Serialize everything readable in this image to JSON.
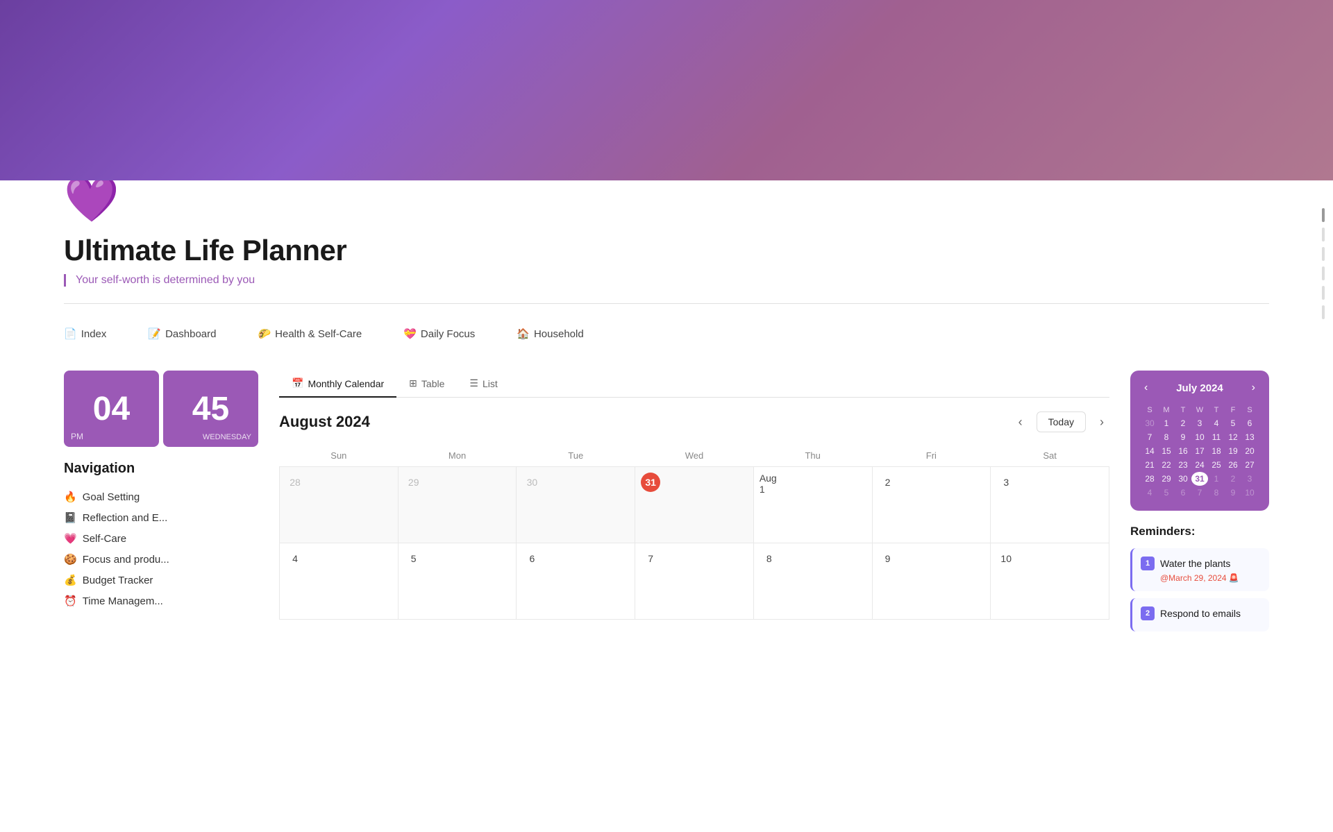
{
  "hero": {
    "gradient": "linear-gradient(135deg, #6b3fa0 0%, #8b5cc9 30%, #a06090 60%, #b07890 100%)"
  },
  "page": {
    "icon": "💜",
    "title": "Ultimate Life Planner",
    "subtitle": "Your self-worth is determined by you"
  },
  "top_nav": {
    "items": [
      {
        "emoji": "📄",
        "label": "Index"
      },
      {
        "emoji": "📝",
        "label": "Dashboard"
      },
      {
        "emoji": "🌮",
        "label": "Health & Self-Care"
      },
      {
        "emoji": "💝",
        "label": "Daily Focus"
      },
      {
        "emoji": "🏠",
        "label": "Household"
      }
    ]
  },
  "clock": {
    "hour": "04",
    "minute": "45",
    "period": "PM",
    "day": "WEDNESDAY"
  },
  "navigation": {
    "title": "Navigation",
    "items": [
      {
        "emoji": "🔥",
        "label": "Goal Setting"
      },
      {
        "emoji": "📓",
        "label": "Reflection and E..."
      },
      {
        "emoji": "💗",
        "label": "Self-Care"
      },
      {
        "emoji": "🍪",
        "label": "Focus and produ..."
      },
      {
        "emoji": "💰",
        "label": "Budget Tracker"
      },
      {
        "emoji": "⏰",
        "label": "Time Managem..."
      }
    ]
  },
  "view_tabs": {
    "tabs": [
      {
        "icon": "📅",
        "label": "Monthly Calendar",
        "active": true
      },
      {
        "icon": "⊞",
        "label": "Table",
        "active": false
      },
      {
        "icon": "☰",
        "label": "List",
        "active": false
      }
    ]
  },
  "calendar": {
    "month_title": "August 2024",
    "today_label": "Today",
    "day_headers": [
      "Sun",
      "Mon",
      "Tue",
      "Wed",
      "Thu",
      "Fri",
      "Sat"
    ],
    "weeks": [
      [
        {
          "num": 28,
          "current": false
        },
        {
          "num": 29,
          "current": false
        },
        {
          "num": 30,
          "current": false
        },
        {
          "num": 31,
          "current": false,
          "today": true
        },
        {
          "num": "Aug 1",
          "current": true
        },
        {
          "num": 2,
          "current": true
        },
        {
          "num": 3,
          "current": true
        }
      ],
      [
        {
          "num": 4,
          "current": true
        },
        {
          "num": 5,
          "current": true
        },
        {
          "num": 6,
          "current": true
        },
        {
          "num": 7,
          "current": true
        },
        {
          "num": 8,
          "current": true
        },
        {
          "num": 9,
          "current": true
        },
        {
          "num": 10,
          "current": true
        }
      ]
    ]
  },
  "mini_calendar": {
    "title": "July 2024",
    "day_headers": [
      "S",
      "M",
      "T",
      "W",
      "T",
      "F",
      "S"
    ],
    "weeks": [
      [
        {
          "num": 30,
          "other": true
        },
        {
          "num": 1,
          "other": false
        },
        {
          "num": 2,
          "other": false
        },
        {
          "num": 3,
          "other": false
        },
        {
          "num": 4,
          "other": false
        },
        {
          "num": 5,
          "other": false
        },
        {
          "num": 6,
          "other": false
        }
      ],
      [
        {
          "num": 7,
          "other": false
        },
        {
          "num": 8,
          "other": false
        },
        {
          "num": 9,
          "other": false
        },
        {
          "num": 10,
          "other": false
        },
        {
          "num": 11,
          "other": false
        },
        {
          "num": 12,
          "other": false
        },
        {
          "num": 13,
          "other": false
        }
      ],
      [
        {
          "num": 14,
          "other": false
        },
        {
          "num": 15,
          "other": false
        },
        {
          "num": 16,
          "other": false
        },
        {
          "num": 17,
          "other": false
        },
        {
          "num": 18,
          "other": false
        },
        {
          "num": 19,
          "other": false
        },
        {
          "num": 20,
          "other": false
        }
      ],
      [
        {
          "num": 21,
          "other": false
        },
        {
          "num": 22,
          "other": false
        },
        {
          "num": 23,
          "other": false
        },
        {
          "num": 24,
          "other": false
        },
        {
          "num": 25,
          "other": false
        },
        {
          "num": 26,
          "other": false
        },
        {
          "num": 27,
          "other": false
        }
      ],
      [
        {
          "num": 28,
          "other": false
        },
        {
          "num": 29,
          "other": false
        },
        {
          "num": 30,
          "other": false
        },
        {
          "num": 31,
          "other": false,
          "selected": true
        },
        {
          "num": 1,
          "other": true
        },
        {
          "num": 2,
          "other": true
        },
        {
          "num": 3,
          "other": true
        }
      ],
      [
        {
          "num": 4,
          "other": true
        },
        {
          "num": 5,
          "other": true
        },
        {
          "num": 6,
          "other": true
        },
        {
          "num": 7,
          "other": true
        },
        {
          "num": 8,
          "other": true
        },
        {
          "num": 9,
          "other": true
        },
        {
          "num": 10,
          "other": true
        }
      ]
    ]
  },
  "reminders": {
    "title": "Reminders:",
    "items": [
      {
        "number": "1",
        "text": "Water the plants",
        "date": "@March 29, 2024 🚨"
      },
      {
        "number": "2",
        "text": "Respond to emails",
        "date": ""
      }
    ]
  }
}
